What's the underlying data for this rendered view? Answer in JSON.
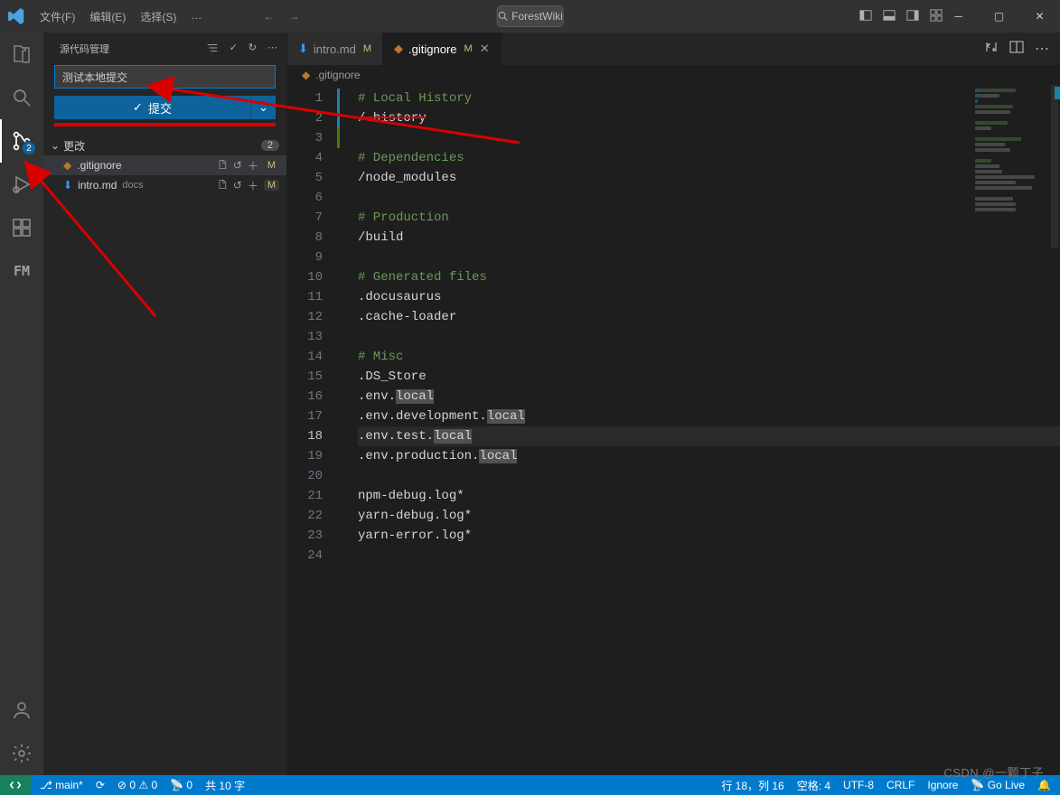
{
  "menu": {
    "file": "文件(F)",
    "edit": "编辑(E)",
    "select": "选择(S)",
    "more": "…"
  },
  "search": {
    "placeholder": "ForestWiki"
  },
  "activity": {
    "scm_badge": "2"
  },
  "scm": {
    "title": "源代码管理",
    "commit_message": "测试本地提交",
    "commit_button": "提交",
    "changes_label": "更改",
    "changes_count": "2",
    "files": [
      {
        "name": ".gitignore",
        "dir": "",
        "status": "M"
      },
      {
        "name": "intro.md",
        "dir": "docs",
        "status": "M"
      }
    ]
  },
  "tabs": [
    {
      "name": "intro.md",
      "status": "M",
      "active": false,
      "icon": "arrowdown"
    },
    {
      "name": ".gitignore",
      "status": "M",
      "active": true,
      "icon": "diamond"
    }
  ],
  "breadcrumb": {
    "file": ".gitignore"
  },
  "editor": {
    "current_line": 18,
    "lines": [
      {
        "n": 1,
        "cls": "comment",
        "text": "# Local History"
      },
      {
        "n": 2,
        "cls": "",
        "text": "/.history",
        "strike": true
      },
      {
        "n": 3,
        "cls": "",
        "text": ""
      },
      {
        "n": 4,
        "cls": "comment",
        "text": "# Dependencies"
      },
      {
        "n": 5,
        "cls": "",
        "text": "/node_modules"
      },
      {
        "n": 6,
        "cls": "",
        "text": ""
      },
      {
        "n": 7,
        "cls": "comment",
        "text": "# Production"
      },
      {
        "n": 8,
        "cls": "",
        "text": "/build"
      },
      {
        "n": 9,
        "cls": "",
        "text": ""
      },
      {
        "n": 10,
        "cls": "comment",
        "text": "# Generated files"
      },
      {
        "n": 11,
        "cls": "",
        "text": ".docusaurus"
      },
      {
        "n": 12,
        "cls": "",
        "text": ".cache-loader"
      },
      {
        "n": 13,
        "cls": "",
        "text": ""
      },
      {
        "n": 14,
        "cls": "comment",
        "text": "# Misc"
      },
      {
        "n": 15,
        "cls": "",
        "text": ".DS_Store"
      },
      {
        "n": 16,
        "cls": "",
        "text_pre": ".env.",
        "hl": "local"
      },
      {
        "n": 17,
        "cls": "",
        "text_pre": ".env.development.",
        "hl": "local"
      },
      {
        "n": 18,
        "cls": "",
        "text_pre": ".env.test.",
        "hl": "local"
      },
      {
        "n": 19,
        "cls": "",
        "text_pre": ".env.production.",
        "hl": "local"
      },
      {
        "n": 20,
        "cls": "",
        "text": ""
      },
      {
        "n": 21,
        "cls": "",
        "text": "npm-debug.log*"
      },
      {
        "n": 22,
        "cls": "",
        "text": "yarn-debug.log*"
      },
      {
        "n": 23,
        "cls": "",
        "text": "yarn-error.log*"
      },
      {
        "n": 24,
        "cls": "",
        "text": ""
      }
    ]
  },
  "status": {
    "branch": "main*",
    "sync": "",
    "errors": "0",
    "warnings": "0",
    "port": "0",
    "wordcount": "共 10 字",
    "ln_col": "行 18，列 16",
    "spaces": "空格: 4",
    "encoding": "UTF-8",
    "eol": "CRLF",
    "lang": "Ignore",
    "golive": "Go Live"
  },
  "watermark": "CSDN @一颗丁子"
}
